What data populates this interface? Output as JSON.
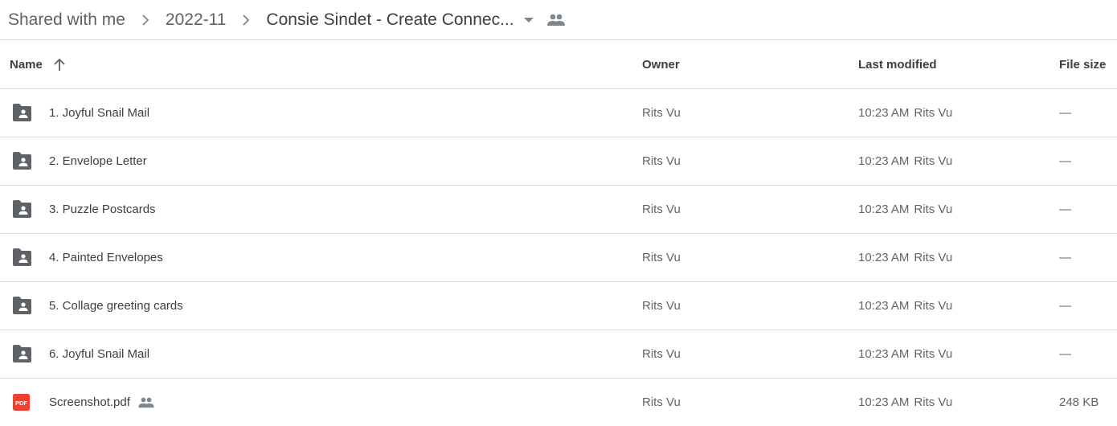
{
  "breadcrumb": {
    "items": [
      {
        "label": "Shared with me"
      },
      {
        "label": "2022-11"
      },
      {
        "label": "Consie Sindet - Create Connec..."
      }
    ],
    "separator_icon": "chevron-right-icon",
    "dropdown_icon": "arrow-drop-down-icon",
    "shared_icon": "people-icon"
  },
  "table": {
    "headers": {
      "name": "Name",
      "owner": "Owner",
      "last_modified": "Last modified",
      "file_size": "File size"
    },
    "sort": {
      "column": "name",
      "direction": "ascending",
      "icon": "arrow-up-icon"
    },
    "rows": [
      {
        "name": "1. Joyful Snail Mail",
        "type": "shared-folder",
        "owner": "Rits Vu",
        "modified_time": "10:23 AM",
        "modified_by": "Rits Vu",
        "size": "—",
        "shared": false
      },
      {
        "name": "2. Envelope Letter",
        "type": "shared-folder",
        "owner": "Rits Vu",
        "modified_time": "10:23 AM",
        "modified_by": "Rits Vu",
        "size": "—",
        "shared": false
      },
      {
        "name": "3. Puzzle Postcards",
        "type": "shared-folder",
        "owner": "Rits Vu",
        "modified_time": "10:23 AM",
        "modified_by": "Rits Vu",
        "size": "—",
        "shared": false
      },
      {
        "name": "4. Painted Envelopes",
        "type": "shared-folder",
        "owner": "Rits Vu",
        "modified_time": "10:23 AM",
        "modified_by": "Rits Vu",
        "size": "—",
        "shared": false
      },
      {
        "name": "5. Collage greeting cards",
        "type": "shared-folder",
        "owner": "Rits Vu",
        "modified_time": "10:23 AM",
        "modified_by": "Rits Vu",
        "size": "—",
        "shared": false
      },
      {
        "name": "6. Joyful Snail Mail",
        "type": "shared-folder",
        "owner": "Rits Vu",
        "modified_time": "10:23 AM",
        "modified_by": "Rits Vu",
        "size": "—",
        "shared": false
      },
      {
        "name": "Screenshot.pdf",
        "type": "pdf",
        "owner": "Rits Vu",
        "modified_time": "10:23 AM",
        "modified_by": "Rits Vu",
        "size": "248 KB",
        "shared": true
      }
    ]
  },
  "colors": {
    "folder_icon": "#5f6368",
    "pdf_icon": "#ea4335",
    "divider": "#dadce0",
    "text_primary": "#3c4043",
    "text_secondary": "#5f6368"
  },
  "icons": {
    "pdf_label": "PDF"
  }
}
